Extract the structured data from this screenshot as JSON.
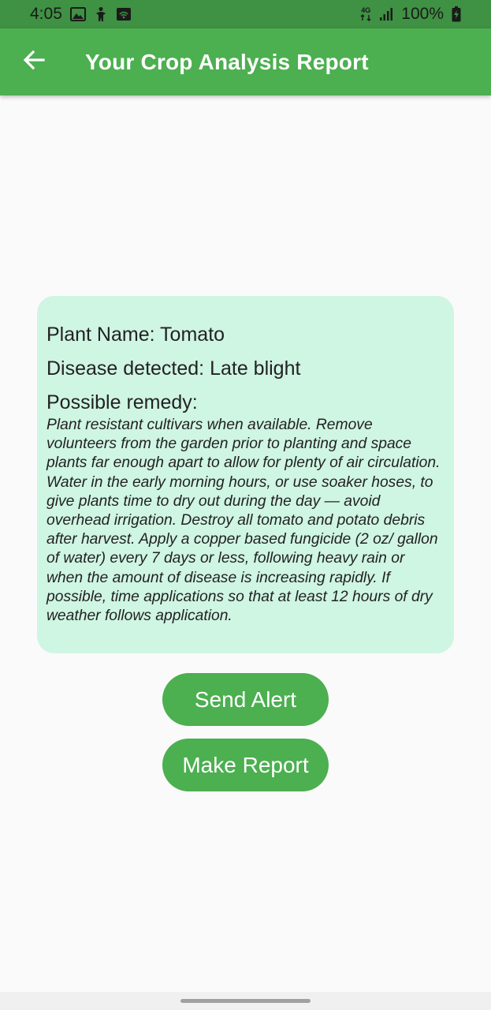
{
  "status_bar": {
    "time": "4:05",
    "network_label": "4G",
    "battery": "100%",
    "left_icons": [
      "image-icon",
      "accessibility-icon",
      "wifi-hotspot-icon"
    ],
    "right_icons": [
      "network-arrows-icon",
      "signal-icon",
      "battery-charging-icon"
    ]
  },
  "app_bar": {
    "title": "Your Crop Analysis Report",
    "back_icon": "arrow-back-icon",
    "color": "#4caf50"
  },
  "report": {
    "plant_name": "Plant Name: Tomato",
    "disease": "Disease detected: Late blight",
    "remedy_heading": "Possible remedy:",
    "remedy_text": "Plant resistant cultivars when available. Remove volunteers from the garden prior to planting and space plants far enough apart to allow for plenty of air circulation. Water in the early morning hours, or use soaker hoses, to give plants time to dry out during the day — avoid overhead irrigation. Destroy all tomato and potato debris after harvest. Apply a copper based fungicide (2 oz/ gallon of water) every 7 days or less, following heavy rain or when the amount of disease is increasing rapidly. If possible, time applications so that at least 12 hours of dry weather follows application.",
    "card_color": "#cff5e3"
  },
  "actions": {
    "send_alert": "Send Alert",
    "make_report": "Make Report",
    "button_color": "#4caf50"
  }
}
